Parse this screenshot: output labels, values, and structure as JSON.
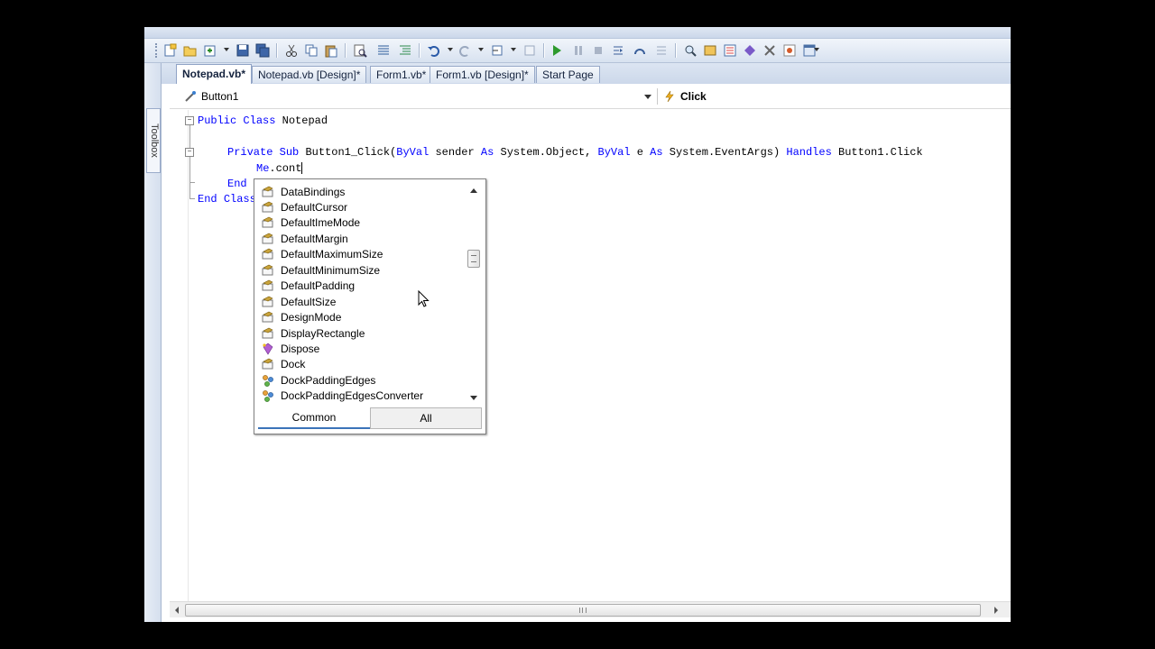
{
  "doc_tabs": [
    {
      "label": "Notepad.vb*",
      "active": true
    },
    {
      "label": "Notepad.vb [Design]*",
      "active": false
    },
    {
      "label": "Form1.vb*",
      "active": false
    },
    {
      "label": "Form1.vb [Design]*",
      "active": false
    },
    {
      "label": "Start Page",
      "active": false
    }
  ],
  "toolbox_label": "Toolbox",
  "nav": {
    "class_combo": "Button1",
    "method_combo": "Click"
  },
  "code": {
    "line1_kw1": "Public",
    "line1_kw2": "Class",
    "line1_name": "Notepad",
    "line2_kw1": "Private",
    "line2_kw2": "Sub",
    "line2_name": "Button1_Click(",
    "line2_kw3": "ByVal",
    "line2_p1": " sender ",
    "line2_kw4": "As",
    "line2_t1": " System.Object, ",
    "line2_kw5": "ByVal",
    "line2_p2": " e ",
    "line2_kw6": "As",
    "line2_t2": " System.EventArgs) ",
    "line2_kw7": "Handles",
    "line2_h": " Button1.Click",
    "line3_me": "Me",
    "line3_rest": ".cont",
    "line4_kw": "End",
    "line5_kw1": "End",
    "line5_kw2": "Class"
  },
  "intellisense": {
    "items": [
      {
        "label": "DataBindings",
        "icon": "property-icon"
      },
      {
        "label": "DefaultCursor",
        "icon": "property-icon"
      },
      {
        "label": "DefaultImeMode",
        "icon": "property-icon"
      },
      {
        "label": "DefaultMargin",
        "icon": "property-icon"
      },
      {
        "label": "DefaultMaximumSize",
        "icon": "property-icon"
      },
      {
        "label": "DefaultMinimumSize",
        "icon": "property-icon"
      },
      {
        "label": "DefaultPadding",
        "icon": "property-icon"
      },
      {
        "label": "DefaultSize",
        "icon": "property-icon"
      },
      {
        "label": "DesignMode",
        "icon": "property-icon"
      },
      {
        "label": "DisplayRectangle",
        "icon": "property-icon"
      },
      {
        "label": "Dispose",
        "icon": "method-icon"
      },
      {
        "label": "Dock",
        "icon": "property-icon"
      },
      {
        "label": "DockPaddingEdges",
        "icon": "class-icon"
      },
      {
        "label": "DockPaddingEdgesConverter",
        "icon": "class-icon"
      }
    ],
    "tab_common": "Common",
    "tab_all": "All"
  },
  "colors": {
    "keyword": "#0000ff",
    "active_tab_underline": "#3b73b9"
  }
}
